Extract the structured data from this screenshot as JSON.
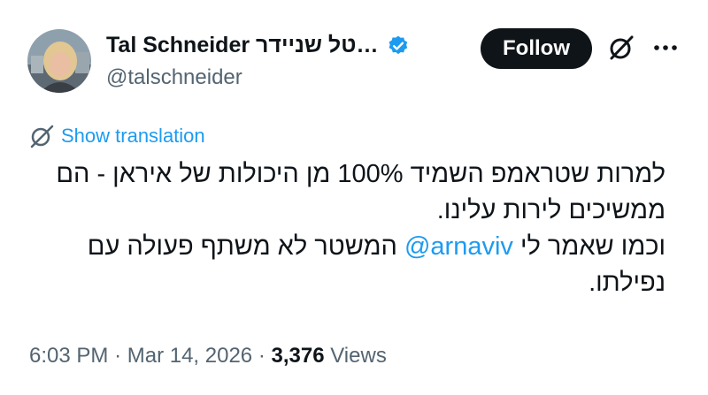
{
  "author": {
    "display_name": "Tal Schneider טל שניידר…",
    "handle": "@talschneider",
    "verified": true
  },
  "follow_label": "Follow",
  "translate_label": "Show translation",
  "tweet_text": {
    "paragraph_1": "למרות שטראמפ השמיד 100% מן היכולות של איראן - הם ממשיכים לירות עלינו.",
    "paragraph_2_before": "וכמו שאמר לי ",
    "mention": "@arnaviv",
    "paragraph_2_after": " המשטר לא משתף פעולה עם נפילתו."
  },
  "meta": {
    "time": "6:03 PM",
    "separator": "·",
    "date": "Mar 14, 2026",
    "views_count": "3,376",
    "views_label": "Views"
  },
  "icons": {
    "verified": "verified-badge-icon",
    "grok": "grok-icon",
    "more": "more-dots-icon",
    "translate": "translate-icon"
  },
  "colors": {
    "accent": "#1d9bf0",
    "text": "#0f1419",
    "secondary": "#536471",
    "follow_bg": "#0f1419"
  }
}
